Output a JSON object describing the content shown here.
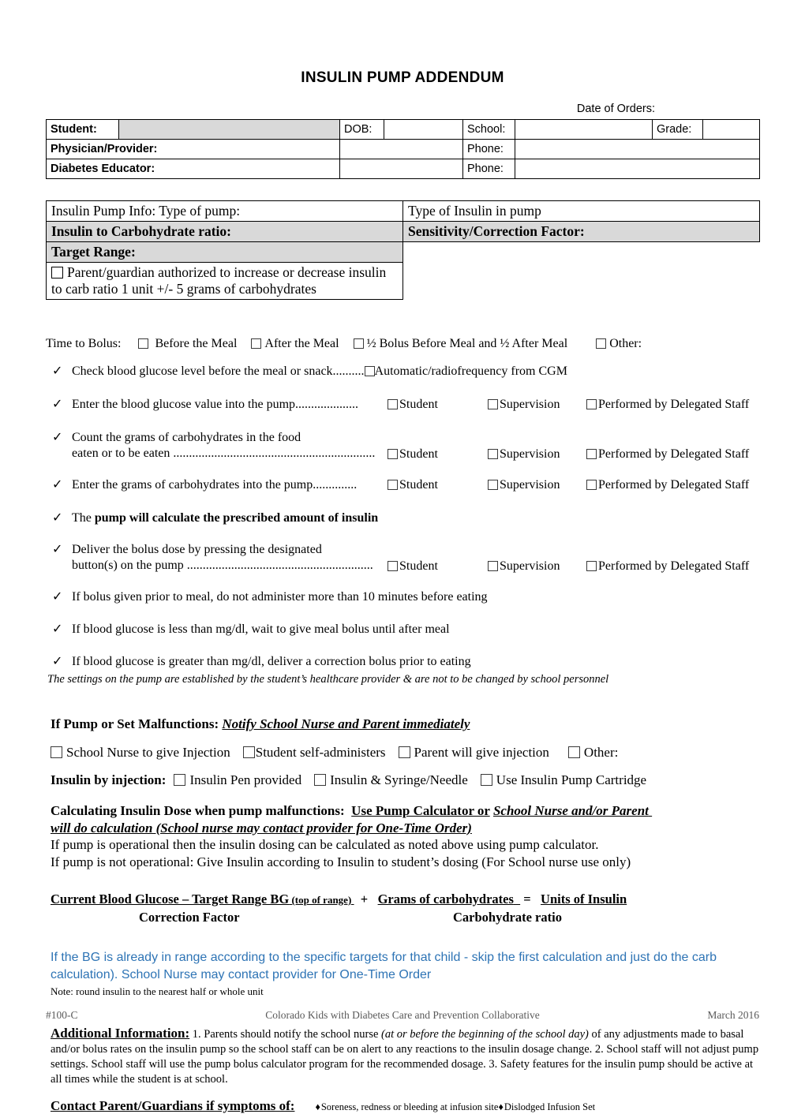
{
  "document": {
    "title": "INSULIN PUMP ADDENDUM",
    "date_of_orders_label": "Date of Orders:"
  },
  "header_table": {
    "student_label": "Student:",
    "dob_label": "DOB:",
    "school_label": "School:",
    "grade_label": "Grade:",
    "physician_label": "Physician/Provider:",
    "phone_label_1": "Phone:",
    "educator_label": "Diabetes Educator:",
    "phone_label_2": "Phone:",
    "student_value": "",
    "dob_value": "",
    "school_value": "",
    "grade_value": "",
    "physician_value": "",
    "phone_value_1": "",
    "educator_value": "",
    "phone_value_2": ""
  },
  "pump_table": {
    "type_of_pump_label": "Insulin Pump Info: Type of pump:",
    "type_of_insulin_label": "Type of Insulin in pump",
    "carb_ratio_label": "Insulin to Carbohydrate ratio:",
    "sensitivity_label": "Sensitivity/Correction Factor:",
    "target_range_label": "Target Range:",
    "parent_auth_text": "Parent/guardian authorized to increase or decrease insulin to carb ratio 1 unit +/- 5 grams of carbohydrates"
  },
  "time_to_bolus": {
    "label": "Time to Bolus:",
    "options": [
      "Before the Meal",
      "After the Meal",
      "½ Bolus Before Meal and ½ After Meal",
      "Other:"
    ]
  },
  "checklist": {
    "tick_glyph": "✓",
    "items": [
      {
        "text": "Check blood glucose level before the meal or snack",
        "dots": "..........",
        "options": [
          "Automatic/radiofrequency from CGM"
        ]
      },
      {
        "text": "Enter the blood glucose value into the pump",
        "dots": "....................",
        "options": [
          "Student",
          "Supervision",
          "Performed by Delegated Staff"
        ]
      },
      {
        "line1": "Count the grams of carbohydrates in the food",
        "line2": "eaten or to be eaten ",
        "dots": "................................................................",
        "options": [
          "Student",
          "Supervision",
          "Performed by Delegated Staff"
        ]
      },
      {
        "text": "Enter the grams of carbohydrates into the pump",
        "dots": "..............",
        "options": [
          "Student",
          "Supervision",
          "Performed by Delegated Staff"
        ]
      },
      {
        "prefix": "The ",
        "bold": "pump will calculate the prescribed amount of insulin"
      },
      {
        "line1": "Deliver the bolus dose by pressing the designated",
        "line2": "button(s) on the pump ",
        "dots": "...........................................................",
        "options": [
          "Student",
          "Supervision",
          "Performed by Delegated Staff"
        ]
      },
      {
        "text": "If bolus given prior to meal, do not administer more than 10 minutes before eating"
      },
      {
        "text": "If blood glucose is less than  mg/dl, wait to give meal bolus until after meal"
      },
      {
        "text": "If blood glucose is greater than  mg/dl, deliver a correction bolus prior to eating"
      }
    ],
    "settings_note": "The settings on the pump are established by the student’s healthcare provider & are not to be changed by school personnel"
  },
  "malfunction": {
    "heading_label": "If Pump or Set Malfunctions:",
    "heading_emphasis": "Notify School Nurse and Parent immediately",
    "options": [
      "School Nurse to give Injection",
      "Student self-administers",
      "Parent  will give injection",
      "Other:"
    ],
    "injection_label": "Insulin by injection:",
    "injection_options": [
      "Insulin Pen provided",
      "Insulin & Syringe/Needle",
      "Use Insulin Pump Cartridge"
    ]
  },
  "calculating": {
    "heading_label": "Calculating Insulin Dose when pump malfunctions:",
    "heading_underline": "Use Pump Calculator or",
    "heading_italic_1": "School Nurse and/or Parent",
    "heading_italic_2": "will do calculation (School nurse may contact provider for One-Time Order)",
    "line1": "If pump is operational then the insulin dosing can be calculated as noted above using pump calculator.",
    "line2": "If pump is not operational: Give Insulin according to Insulin to student’s dosing (For School nurse use only)"
  },
  "formula": {
    "part1": "Current Blood Glucose – Target Range BG",
    "part1_small": "(top of range)",
    "plus": "+",
    "part2": "Grams of carbohydrates",
    "equals": "=",
    "part3": "Units of Insulin",
    "denominator1": "Correction Factor",
    "denominator2": "Carbohydrate ratio"
  },
  "blue_note": {
    "color": "#2E74B5",
    "line1": "If the BG is already in range according to the specific targets for that child  - skip the first calculation and just do the carb",
    "line2": "calculation).  School Nurse may contact provider for One-Time Order",
    "small_note": "Note: round insulin to the nearest half or whole unit"
  },
  "additional": {
    "heading": "Additional Information:",
    "text_1": " 1. Parents should notify the school nurse ",
    "italic_1": "(at or before the beginning of the school day)",
    "text_2": " of any adjustments made to basal and/or bolus rates on the insulin pump so the school staff can be on alert to any reactions to the insulin dosage change. 2. School staff will not adjust pump settings.  School staff will use the pump bolus calculator program for the recommended dosage.  3. Safety features for the insulin pump should be active at all times while the student is at school."
  },
  "contact": {
    "heading": "Contact Parent/Guardians if symptoms of:",
    "bullet_glyph": "♦",
    "symptom_1": "Soreness, redness or bleeding at infusion site",
    "symptom_2": "Dislodged Infusion Set"
  },
  "footer": {
    "form_number": "#100-C",
    "organization": "Colorado Kids with Diabetes Care and Prevention Collaborative",
    "date": "March 2016"
  }
}
